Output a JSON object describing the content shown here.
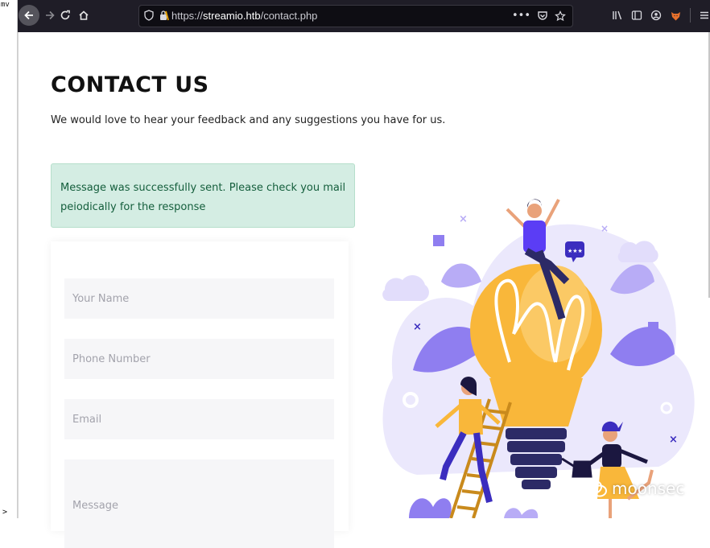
{
  "terminal": {
    "top_text": "mv",
    "bottom_text": ">"
  },
  "browser": {
    "url_prefix": "https://",
    "url_domain": "streamio.htb",
    "url_path": "/contact.php",
    "url_more": "•••"
  },
  "page": {
    "title": "CONTACT US",
    "subtitle": "We would love to hear your feedback and any suggestions you have for us.",
    "alert_message": "Message was successfully sent. Please check you mail peiodically for the response",
    "form": {
      "name_placeholder": "Your Name",
      "phone_placeholder": "Phone Number",
      "email_placeholder": "Email",
      "message_placeholder": "Message"
    }
  },
  "illustration": {
    "bubble_text": "★★★"
  },
  "watermark": {
    "text": "moonsec"
  },
  "colors": {
    "toolbar_bg": "#1f1d27",
    "alert_bg": "#d4ede3",
    "alert_text": "#145e3c",
    "bulb": "#f9b73a",
    "accent_purple": "#5b3df5",
    "lavender": "#cdc4f7"
  }
}
